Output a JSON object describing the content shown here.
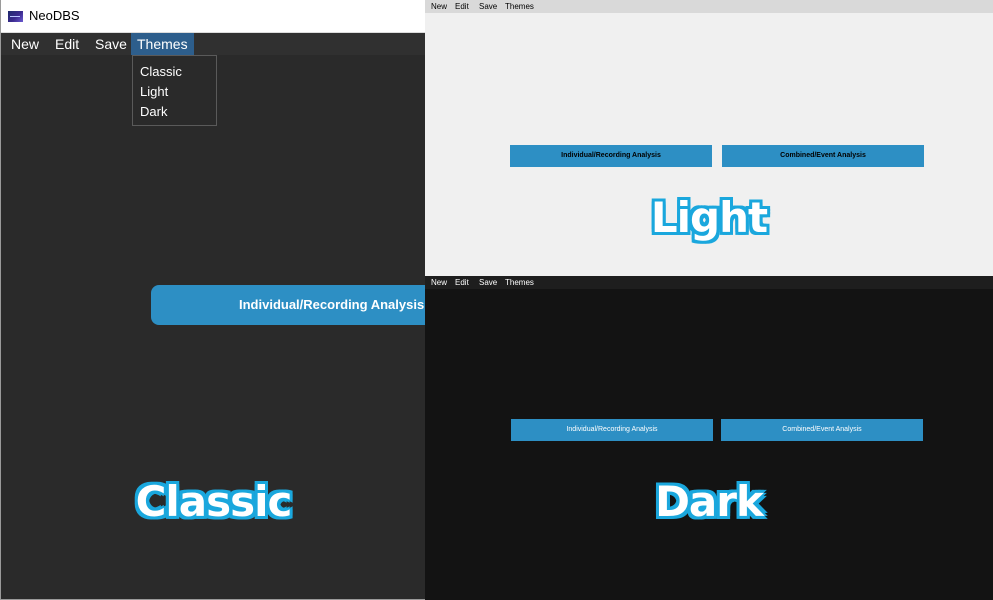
{
  "classic": {
    "app_title": "NeoDBS",
    "app_icon": "neodbs-logo-icon",
    "menu": [
      "New",
      "Edit",
      "Save",
      "Themes"
    ],
    "active_menu": "Themes",
    "dropdown_items": [
      "Classic",
      "Light",
      "Dark"
    ],
    "button_label": "Individual/Recording Analysis",
    "caption": "Classic"
  },
  "light": {
    "menu": [
      "New",
      "Edit",
      "Save",
      "Themes"
    ],
    "buttons": [
      "Individual/Recording Analysis",
      "Combined/Event Analysis"
    ],
    "caption": "Light"
  },
  "dark": {
    "menu": [
      "New",
      "Edit",
      "Save",
      "Themes"
    ],
    "buttons": [
      "Individual/Recording Analysis",
      "Combined/Event Analysis"
    ],
    "caption": "Dark"
  },
  "colors": {
    "accent_button": "#2d8fc4",
    "caption_outline": "#1aa7dd",
    "classic_bg": "#2a2a2a",
    "light_bg": "#f0f0f0",
    "dark_bg": "#131313"
  }
}
